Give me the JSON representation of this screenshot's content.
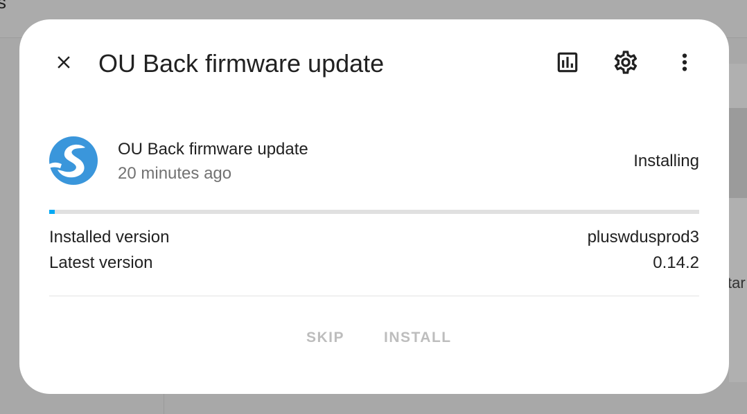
{
  "background": {
    "topbar_fragment": "s",
    "right_fragment": "tar"
  },
  "dialog": {
    "title": "OU Back firmware update",
    "icons": {
      "close": "close-icon",
      "history": "chart-box-outline-icon",
      "settings": "gear-icon",
      "more": "more-vertical-icon"
    }
  },
  "entity": {
    "logo": "brand-s-logo",
    "name": "OU Back firmware update",
    "last_changed": "20 minutes ago",
    "state": "Installing",
    "progress": 0.008,
    "colors": {
      "progress": "#03a9f4",
      "track": "#e0e0e0",
      "logo": "#3a96db"
    }
  },
  "versions": {
    "installed_label": "Installed version",
    "installed_value": "pluswdusprod3",
    "latest_label": "Latest version",
    "latest_value": "0.14.2"
  },
  "actions": {
    "skip_label": "SKIP",
    "install_label": "INSTALL"
  }
}
